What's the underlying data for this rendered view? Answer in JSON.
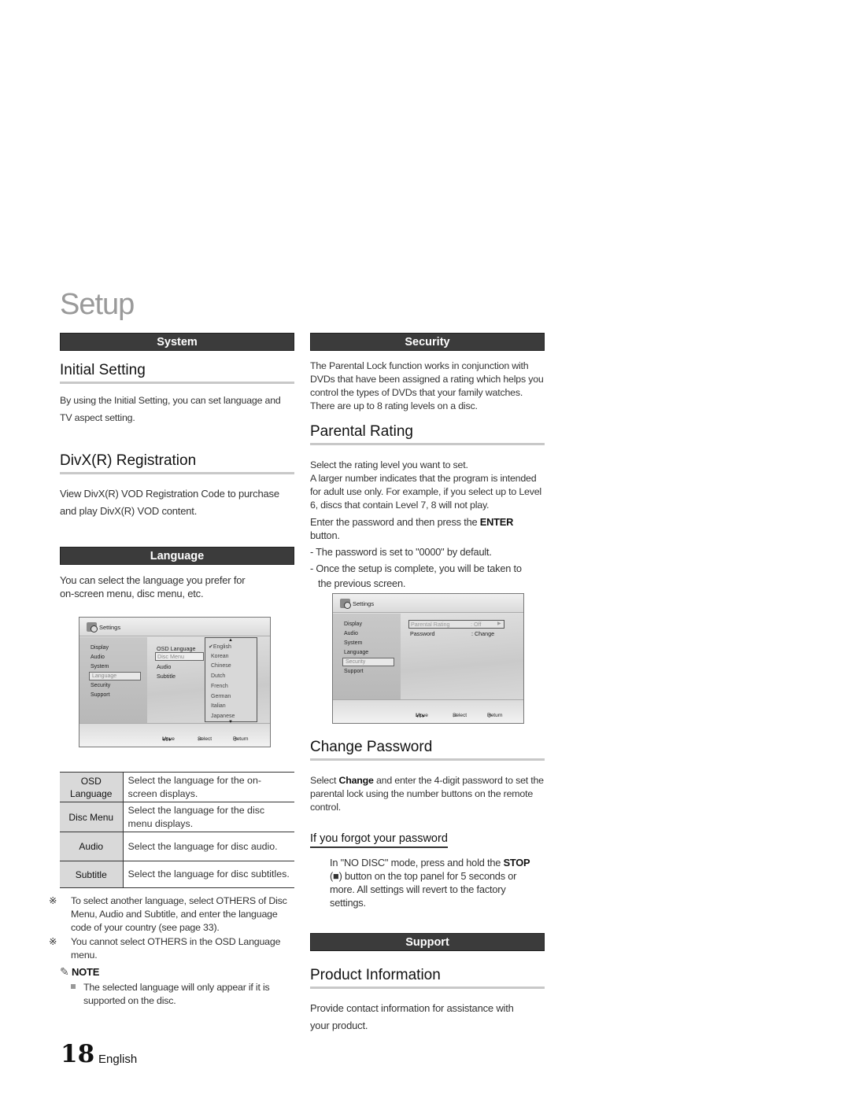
{
  "page": {
    "title": "Setup",
    "number": "18",
    "language": "English"
  },
  "left": {
    "system_bar": "System",
    "initial_setting": {
      "heading": "Initial Setting",
      "text_line1": "By using the Initial Setting, you can set language and",
      "text_line2": "TV aspect setting."
    },
    "divx": {
      "heading": "DivX(R) Registration",
      "text_line1": "View DivX(R) VOD Registration Code to purchase",
      "text_line2": "and play DivX(R) VOD content."
    },
    "language_bar": "Language",
    "language_intro_line1": "You can select the language you prefer for",
    "language_intro_line2": "on-screen menu, disc menu, etc.",
    "screen": {
      "title": "Settings",
      "menu": [
        "Display",
        "Audio",
        "System",
        "Language",
        "Security",
        "Support"
      ],
      "selected_menu": "Language",
      "options": [
        "OSD Language",
        "Disc Menu",
        "Audio",
        "Subtitle"
      ],
      "selected_option": "Disc Menu",
      "dropdown": [
        "English",
        "Korean",
        "Chinese",
        "Dutch",
        "French",
        "German",
        "Italian",
        "Japanese"
      ],
      "checked": "English",
      "footer": {
        "move": "Move",
        "select": "Select",
        "return": "Return"
      }
    },
    "table": [
      {
        "key_line1": "OSD",
        "key_line2": "Language",
        "value_line1": "Select the language for the on-",
        "value_line2": "screen displays."
      },
      {
        "key_line1": "Disc Menu",
        "key_line2": "",
        "value_line1": "Select the language for the disc",
        "value_line2": "menu displays."
      },
      {
        "key_line1": "Audio",
        "key_line2": "",
        "value_line1": "Select the language for disc audio.",
        "value_line2": ""
      },
      {
        "key_line1": "Subtitle",
        "key_line2": "",
        "value_line1": "Select the language for disc subtitles.",
        "value_line2": ""
      }
    ],
    "notes": [
      "To select another language, select OTHERS of Disc Menu, Audio and Subtitle, and enter the language code of your country (see page 33).",
      "You cannot select OTHERS in the OSD Language menu."
    ],
    "note_label": "NOTE",
    "note_bullet": "The selected language will only appear if it is supported on the disc."
  },
  "right": {
    "security_bar": "Security",
    "security_text": "The Parental Lock function works in conjunction with DVDs that have been assigned a rating which helps you control the types of DVDs that your family watches. There are up to 8 rating levels on a disc.",
    "parental": {
      "heading": "Parental Rating",
      "text1": "Select the rating level you want to set.",
      "text2": "A larger number indicates that the program is intended for adult use only. For example, if you select up to Level 6, discs that contain Level 7, 8 will not play.",
      "text3_pre": "Enter the password and then press the ",
      "text3_bold": "ENTER",
      "text3_post": " button.",
      "dash1": "- The password is set to \"0000\" by default.",
      "dash2_line1": "- Once the setup is complete, you will be taken to",
      "dash2_line2": "the previous screen."
    },
    "screen": {
      "title": "Settings",
      "menu": [
        "Display",
        "Audio",
        "System",
        "Language",
        "Security",
        "Support"
      ],
      "selected_menu": "Security",
      "rows": [
        {
          "label": "Parental Rating",
          "value": ": Off"
        },
        {
          "label": "Password",
          "value": ": Change"
        }
      ],
      "footer": {
        "move": "Move",
        "select": "Select",
        "return": "Return"
      }
    },
    "change_password": {
      "heading": "Change Password",
      "text_pre": "Select ",
      "text_bold": "Change",
      "text_post": " and enter the 4-digit password to set the parental lock using the number buttons on the remote control.",
      "forgot_heading": "If you forgot your password",
      "forgot_pre": "In \"NO DISC\" mode, press and hold the ",
      "forgot_bold": "STOP",
      "forgot_post": " (■) button on the top panel for 5 seconds or more. All settings will revert to the factory settings."
    },
    "support_bar": "Support",
    "product_info": {
      "heading": "Product Information",
      "text_line1": "Provide contact information for assistance with",
      "text_line2": "your product."
    }
  }
}
